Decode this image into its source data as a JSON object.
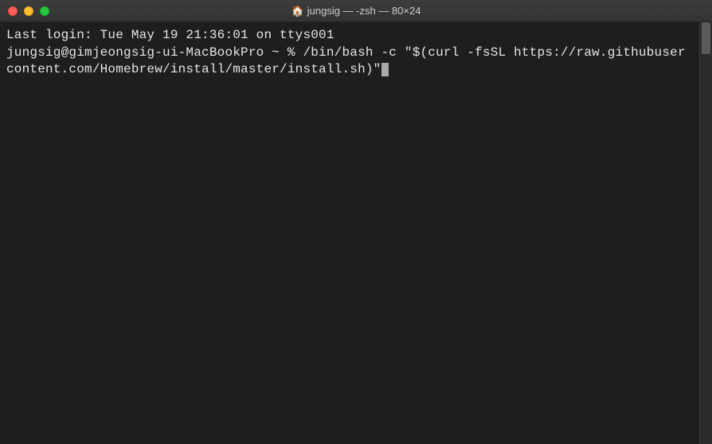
{
  "titlebar": {
    "icon_glyph": "🏠",
    "title": "jungsig — -zsh — 80×24"
  },
  "terminal": {
    "line1": "Last login: Tue May 19 21:36:01 on ttys001",
    "prompt": "jungsig@gimjeongsig-ui-MacBookPro ~ % ",
    "command": "/bin/bash -c \"$(curl -fsSL https://raw.githubusercontent.com/Homebrew/install/master/install.sh)\""
  },
  "colors": {
    "bg": "#1e1e1e",
    "fg": "#e6e6e6"
  }
}
